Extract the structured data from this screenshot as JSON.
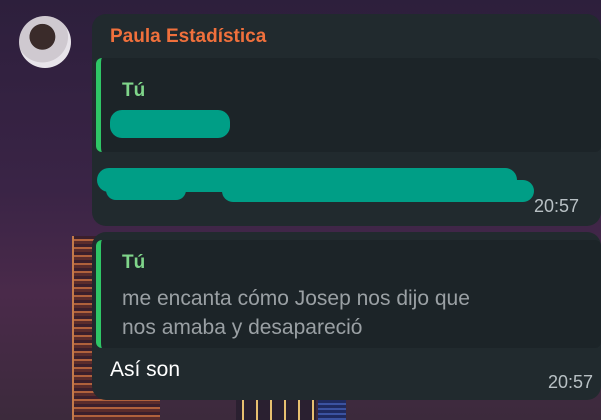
{
  "message1": {
    "sender": "Paula Estadística",
    "quote_author": "Tú",
    "time": "20:57"
  },
  "message2": {
    "quote_author": "Tú",
    "quote_text_line1": "me encanta cómo Josep nos dijo que",
    "quote_text_line2": "nos amaba y desapareció",
    "text": "Así son",
    "time": "20:57"
  },
  "colors": {
    "bubble": "#212a2e",
    "sender_name": "#f0703c",
    "quote_bar": "#2fc666",
    "quote_author": "#7fd58a",
    "redaction": "#009e86"
  }
}
